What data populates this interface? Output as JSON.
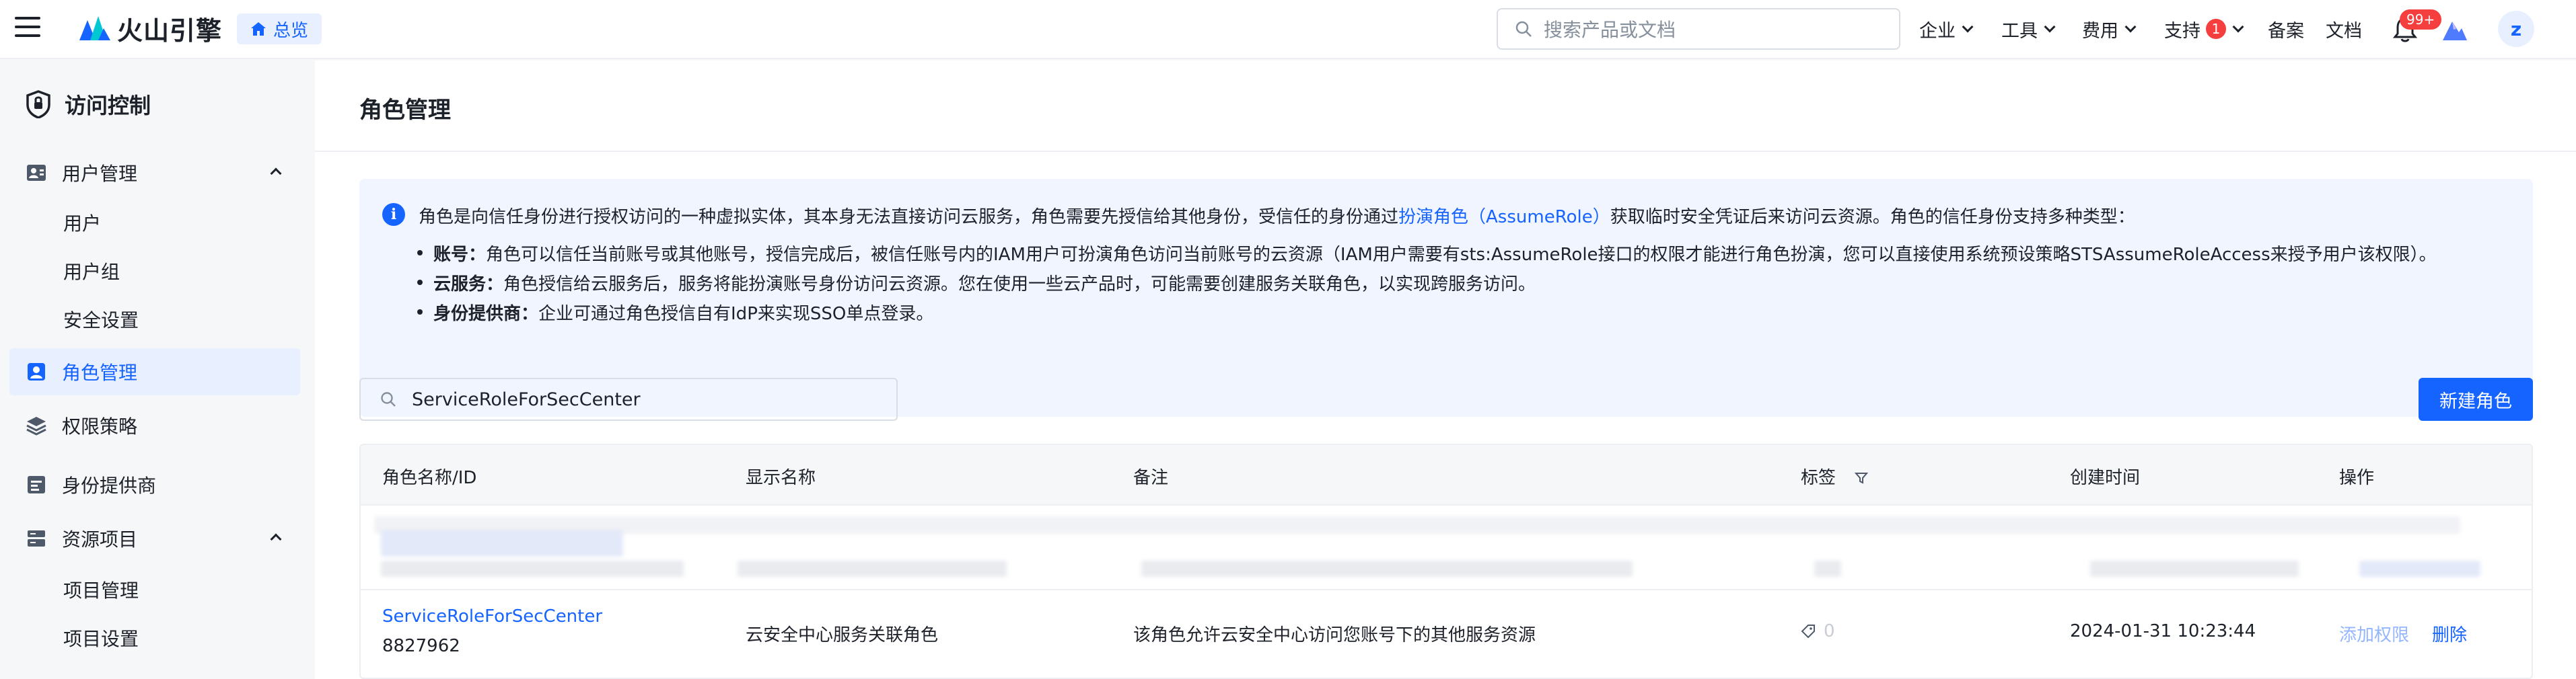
{
  "header": {
    "logo_text": "火山引擎",
    "overview_label": "总览",
    "search_placeholder": "搜索产品或文档",
    "nav": {
      "enterprise": "企业",
      "tools": "工具",
      "billing": "费用",
      "support": "支持",
      "support_badge": "1",
      "record": "备案",
      "docs": "文档"
    },
    "notification_badge": "99+",
    "avatar_letter": "z"
  },
  "sidebar": {
    "title": "访问控制",
    "items": [
      {
        "label": "用户管理",
        "expanded": true
      },
      {
        "label": "用户"
      },
      {
        "label": "用户组"
      },
      {
        "label": "安全设置"
      },
      {
        "label": "角色管理",
        "active": true
      },
      {
        "label": "权限策略"
      },
      {
        "label": "身份提供商"
      },
      {
        "label": "资源项目",
        "expanded": true
      },
      {
        "label": "项目管理"
      },
      {
        "label": "项目设置"
      }
    ]
  },
  "main": {
    "page_title": "角色管理",
    "info": {
      "lead_before": "角色是向信任身份进行授权访问的一种虚拟实体，其本身无法直接访问云服务，角色需要先授信给其他身份，受信任的身份通过",
      "lead_link": "扮演角色（AssumeRole）",
      "lead_after": "获取临时安全凭证后来访问云资源。角色的信任身份支持多种类型：",
      "bullets": [
        {
          "term": "账号：",
          "text": "角色可以信任当前账号或其他账号，授信完成后，被信任账号内的IAM用户可扮演角色访问当前账号的云资源（IAM用户需要有sts:AssumeRole接口的权限才能进行角色扮演，您可以直接使用系统预设策略STSAssumeRoleAccess来授予用户该权限）。"
        },
        {
          "term": "云服务：",
          "text": "角色授信给云服务后，服务将能扮演账号身份访问云资源。您在使用一些云产品时，可能需要创建服务关联角色，以实现跨服务访问。"
        },
        {
          "term": "身份提供商：",
          "text": "企业可通过角色授信自有IdP来实现SSO单点登录。"
        }
      ]
    },
    "search_value": "ServiceRoleForSecCenter",
    "new_role_button": "新建角色",
    "table": {
      "columns": [
        "角色名称/ID",
        "显示名称",
        "备注",
        "标签",
        "创建时间",
        "操作"
      ],
      "rows": [
        {
          "role_name": "ServiceRoleForSecCenter",
          "role_id": "8827962",
          "display_name": "云安全中心服务关联角色",
          "note": "该角色允许云安全中心访问您账号下的其他服务资源",
          "tag_count": "0",
          "created_at": "2024-01-31 10:23:44",
          "actions": [
            "添加权限",
            "删除"
          ]
        }
      ]
    }
  },
  "colors": {
    "accent": "#1664ff",
    "badge_red": "#f53f3f",
    "info_bg": "#f0f5ff"
  }
}
